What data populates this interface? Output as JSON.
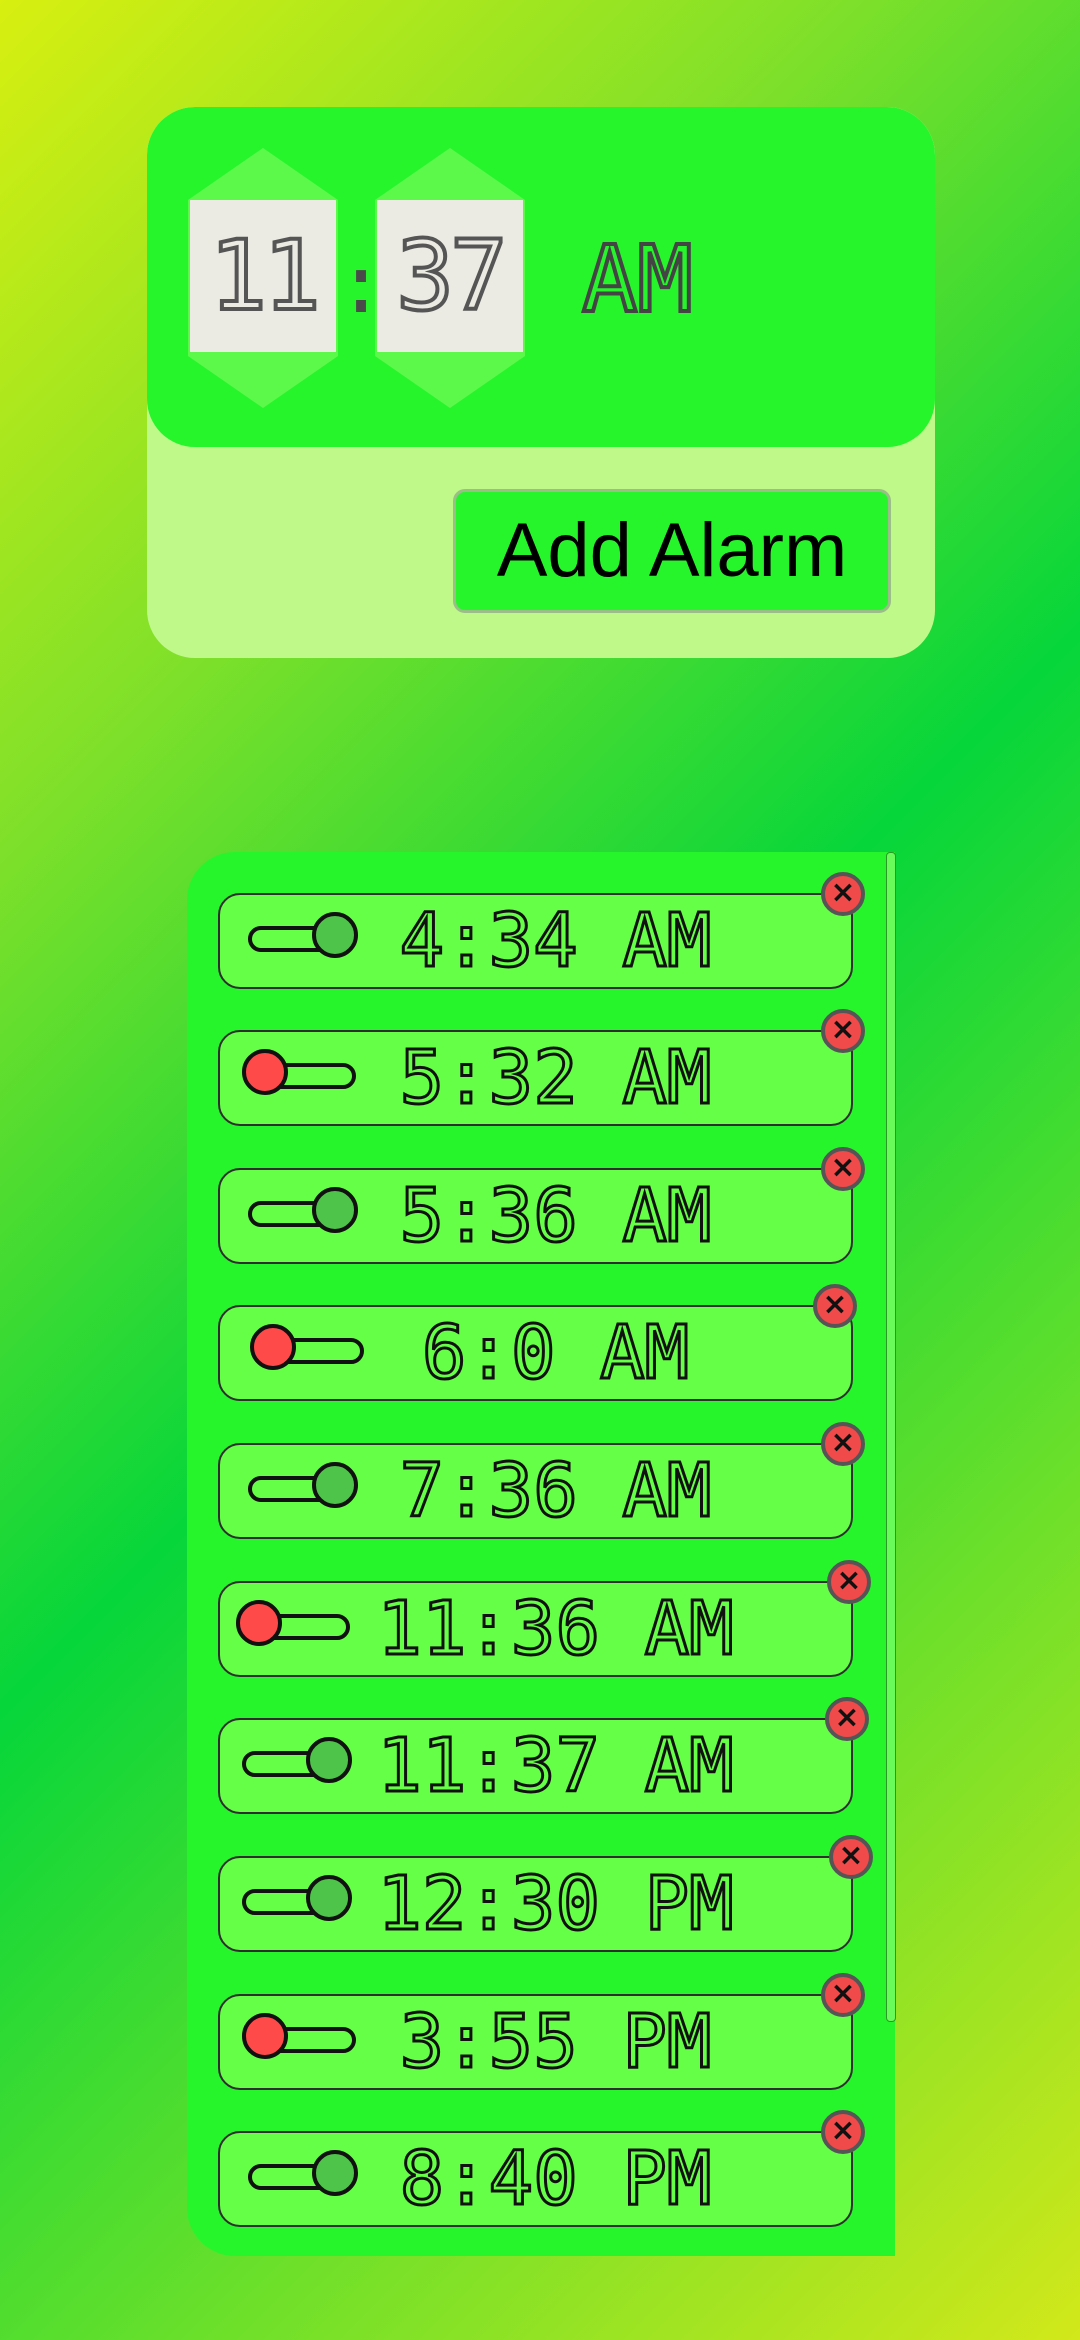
{
  "time_picker": {
    "hour": "11",
    "separator": ":",
    "minute": "37",
    "meridiem": "AM",
    "add_button_label": "Add Alarm"
  },
  "alarms": [
    {
      "time": "4:34 AM",
      "enabled": true
    },
    {
      "time": "5:32 AM",
      "enabled": false
    },
    {
      "time": "5:36 AM",
      "enabled": true
    },
    {
      "time": "6:0 AM",
      "enabled": false
    },
    {
      "time": "7:36 AM",
      "enabled": true
    },
    {
      "time": "11:36 AM",
      "enabled": false
    },
    {
      "time": "11:37 AM",
      "enabled": true
    },
    {
      "time": "12:30 PM",
      "enabled": true
    },
    {
      "time": "3:55 PM",
      "enabled": false
    },
    {
      "time": "8:40 PM",
      "enabled": true
    }
  ],
  "icons": {
    "delete": "close-icon",
    "delete_glyph": "×"
  },
  "colors": {
    "toggle_on": "#4ec44a",
    "toggle_off": "#ff4a4a",
    "delete_button": "#f04a4a",
    "accent": "#27f52c"
  }
}
